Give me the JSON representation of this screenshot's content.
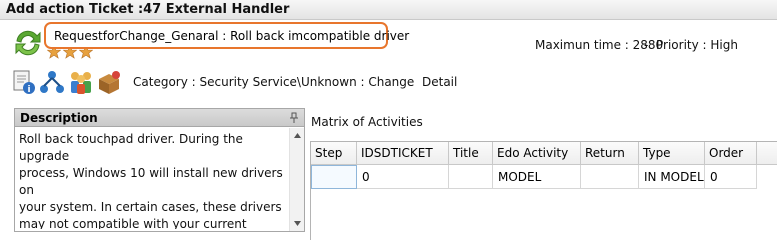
{
  "window": {
    "title": "Add action Ticket :47 External Handler"
  },
  "header": {
    "request_title": "RequestforChange_Genaral : Roll back imcompatible driver",
    "max_time": "Maximun time : 2880",
    "priority": "Priority : High",
    "stars": 3,
    "icons": [
      "refresh-icon",
      "star-icon"
    ]
  },
  "toolbar": {
    "icons": [
      "document-info-icon",
      "sitemap-icon",
      "users-icon",
      "package-icon"
    ],
    "category": "Category : Security Service\\Unknown : Change",
    "detail_label": "Detail"
  },
  "description": {
    "label": "Description",
    "text": "Roll back touchpad driver. During the upgrade\nprocess, Windows 10 will install new drivers on\nyour system. In certain cases, these drivers\nmay not compatible with your current\nhardware."
  },
  "matrix": {
    "label": "Matrix of Activities",
    "columns": [
      "Step",
      "IDSDTICKET",
      "Title",
      "Edo Activity",
      "Return",
      "Type",
      "Order"
    ],
    "rows": [
      [
        "",
        "0",
        "",
        "MODEL",
        "",
        "IN MODEL",
        "0"
      ]
    ]
  },
  "colors": {
    "highlight_border": "#e8762d",
    "star": "#e7a13f",
    "refresh": "#5aa832"
  }
}
